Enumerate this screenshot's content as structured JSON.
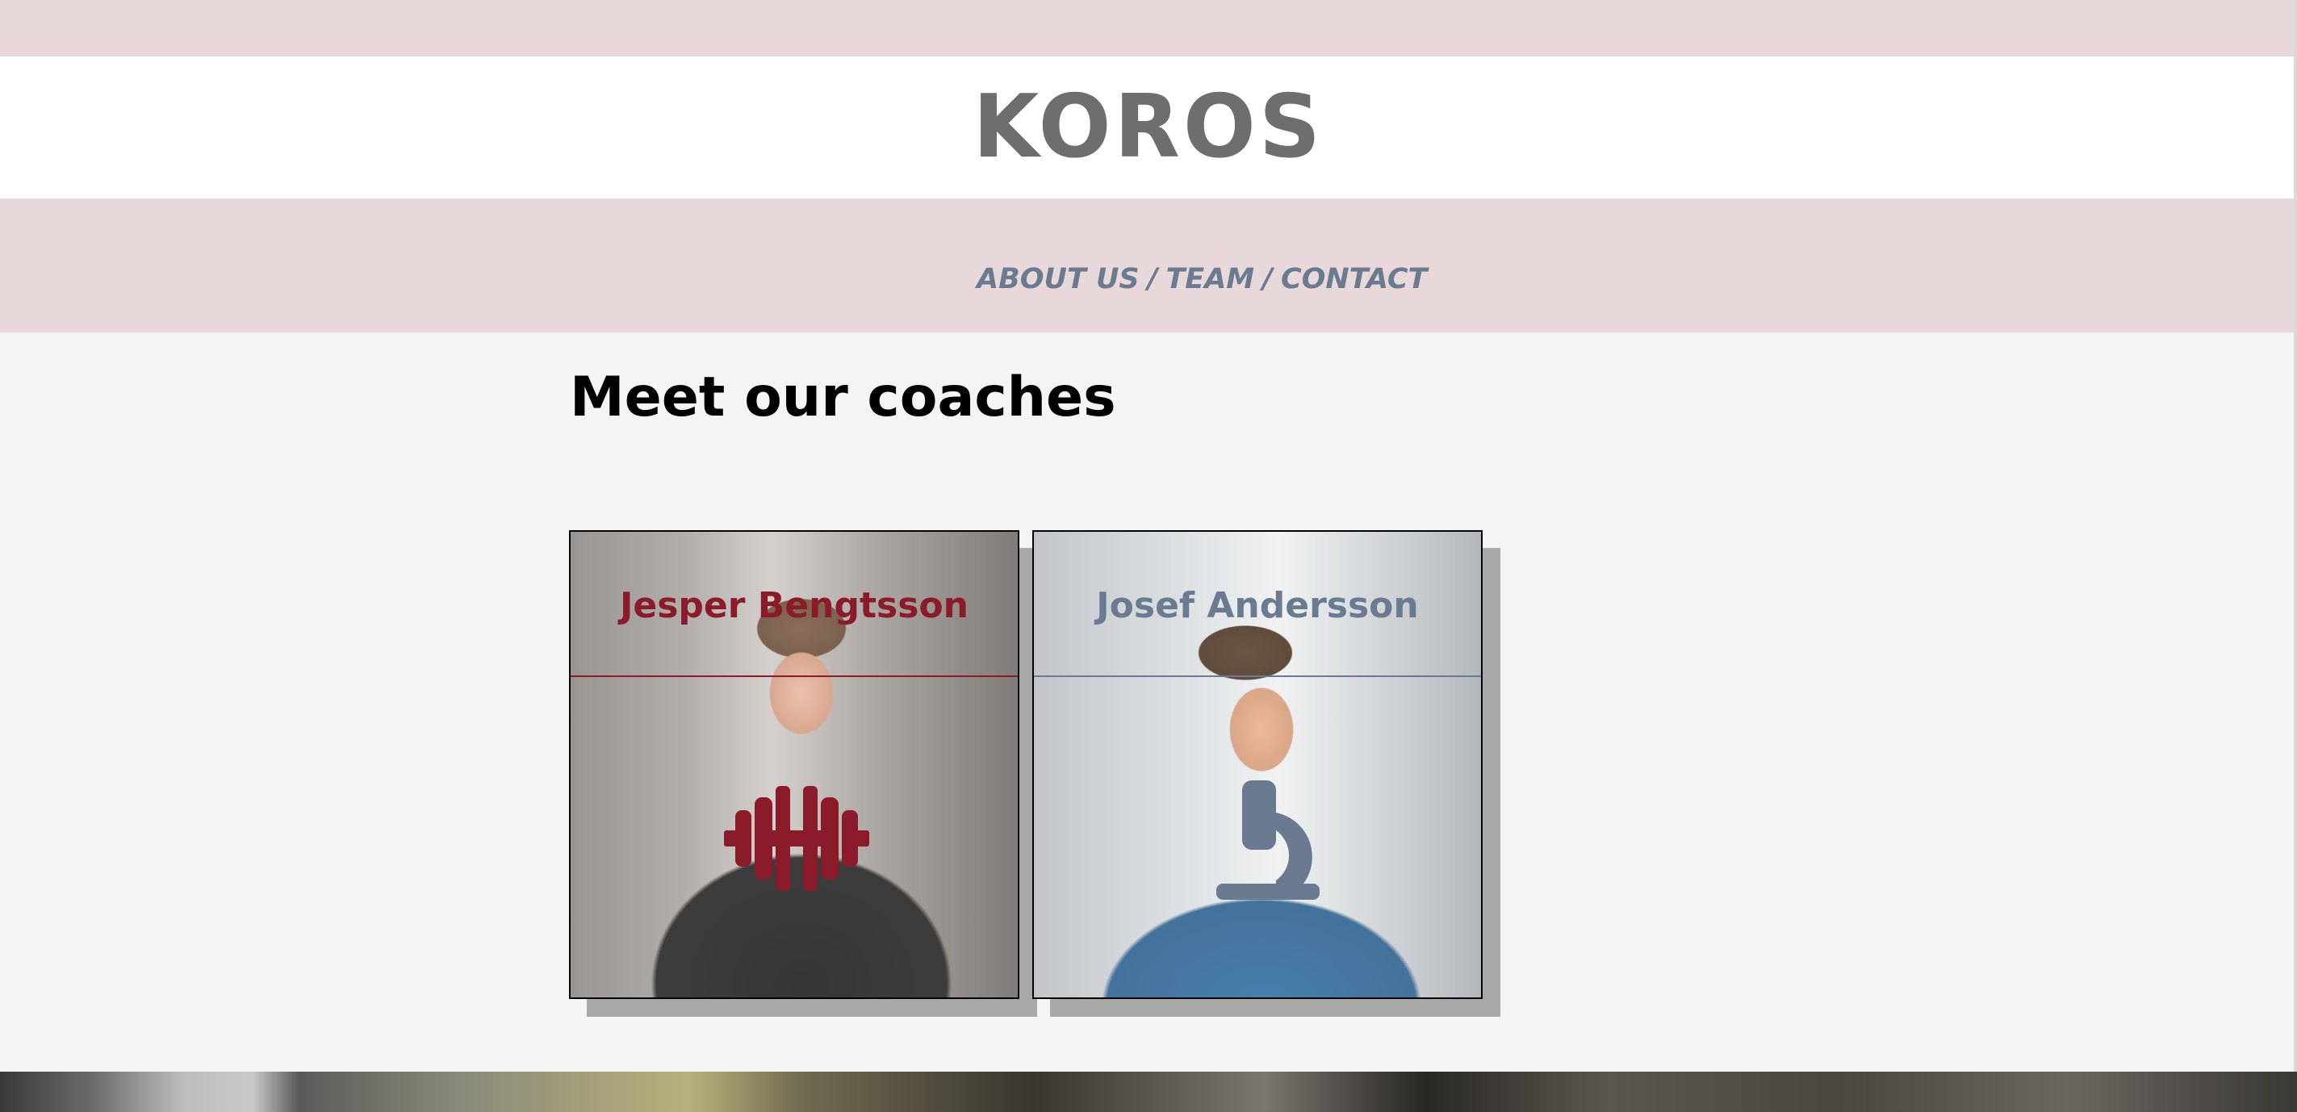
{
  "header": {
    "brand": "KOROS"
  },
  "nav": {
    "items": [
      {
        "label": "ABOUT US"
      },
      {
        "sep": "/"
      },
      {
        "label": "TEAM"
      },
      {
        "sep": "/"
      },
      {
        "label": "CONTACT"
      }
    ]
  },
  "main": {
    "title": "Meet our coaches",
    "coaches": [
      {
        "name": "Jesper Bengtsson",
        "icon": "dumbbell-icon",
        "accent": "#8b1a2b"
      },
      {
        "name": "Josef Andersson",
        "icon": "microscope-icon",
        "accent": "#6a7a91"
      }
    ]
  },
  "colors": {
    "pink_band": "#e9d8da",
    "page_bg": "#f4f4f4",
    "logo_gray": "#6e6e6e",
    "nav_slate": "#6a7a91",
    "accent_red": "#8b1a2b"
  }
}
